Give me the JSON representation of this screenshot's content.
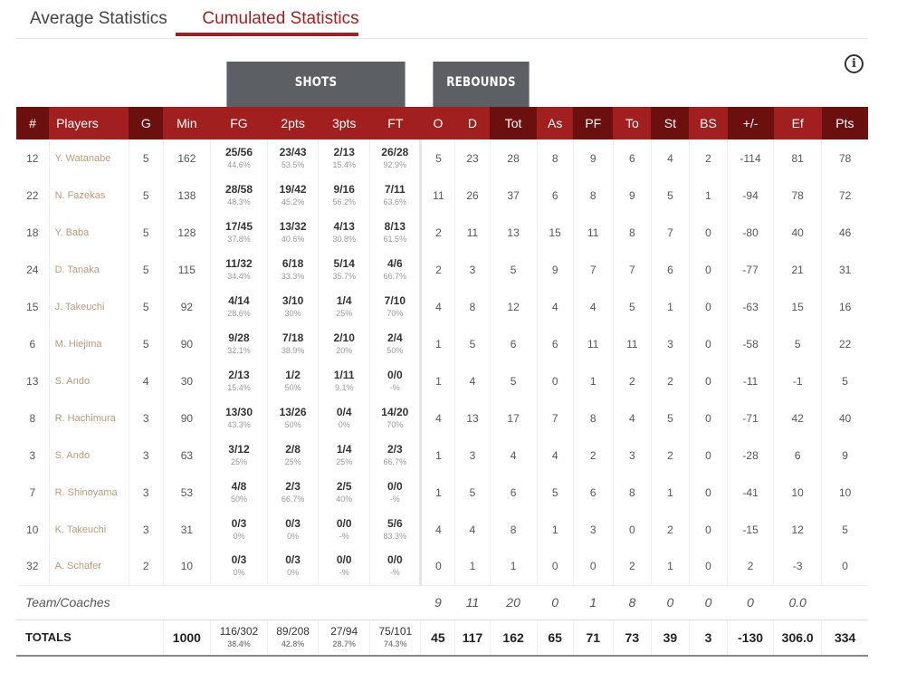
{
  "tabs": [
    "Average Statistics",
    "Cumulated Statistics"
  ],
  "active_tab": "Cumulated Statistics",
  "groups": {
    "shots": "SHOTS",
    "rebounds": "REBOUNDS"
  },
  "info_icon": "i",
  "columns": [
    "#",
    "Players",
    "G",
    "Min",
    "FG",
    "2pts",
    "3pts",
    "FT",
    "O",
    "D",
    "Tot",
    "As",
    "PF",
    "To",
    "St",
    "BS",
    "+/-",
    "Ef",
    "Pts"
  ],
  "players": [
    {
      "num": "12",
      "name": "Y. Watanabe",
      "g": "5",
      "min": "162",
      "fg": "25/56",
      "fgp": "44.6%",
      "p2": "23/43",
      "p2p": "53.5%",
      "p3": "2/13",
      "p3p": "15.4%",
      "ft": "26/28",
      "ftp": "92.9%",
      "o": "5",
      "d": "23",
      "tot": "28",
      "as": "8",
      "pf": "9",
      "to": "6",
      "st": "4",
      "bs": "2",
      "pm": "-114",
      "ef": "81",
      "pts": "78"
    },
    {
      "num": "22",
      "name": "N. Fazekas",
      "g": "5",
      "min": "138",
      "fg": "28/58",
      "fgp": "48.3%",
      "p2": "19/42",
      "p2p": "45.2%",
      "p3": "9/16",
      "p3p": "56.2%",
      "ft": "7/11",
      "ftp": "63.6%",
      "o": "11",
      "d": "26",
      "tot": "37",
      "as": "6",
      "pf": "8",
      "to": "9",
      "st": "5",
      "bs": "1",
      "pm": "-94",
      "ef": "78",
      "pts": "72"
    },
    {
      "num": "18",
      "name": "Y. Baba",
      "g": "5",
      "min": "128",
      "fg": "17/45",
      "fgp": "37.8%",
      "p2": "13/32",
      "p2p": "40.6%",
      "p3": "4/13",
      "p3p": "30.8%",
      "ft": "8/13",
      "ftp": "61.5%",
      "o": "2",
      "d": "11",
      "tot": "13",
      "as": "15",
      "pf": "11",
      "to": "8",
      "st": "7",
      "bs": "0",
      "pm": "-80",
      "ef": "40",
      "pts": "46"
    },
    {
      "num": "24",
      "name": "D. Tanaka",
      "g": "5",
      "min": "115",
      "fg": "11/32",
      "fgp": "34.4%",
      "p2": "6/18",
      "p2p": "33.3%",
      "p3": "5/14",
      "p3p": "35.7%",
      "ft": "4/6",
      "ftp": "66.7%",
      "o": "2",
      "d": "3",
      "tot": "5",
      "as": "9",
      "pf": "7",
      "to": "7",
      "st": "6",
      "bs": "0",
      "pm": "-77",
      "ef": "21",
      "pts": "31"
    },
    {
      "num": "15",
      "name": "J. Takeuchi",
      "g": "5",
      "min": "92",
      "fg": "4/14",
      "fgp": "28.6%",
      "p2": "3/10",
      "p2p": "30%",
      "p3": "1/4",
      "p3p": "25%",
      "ft": "7/10",
      "ftp": "70%",
      "o": "4",
      "d": "8",
      "tot": "12",
      "as": "4",
      "pf": "4",
      "to": "5",
      "st": "1",
      "bs": "0",
      "pm": "-63",
      "ef": "15",
      "pts": "16"
    },
    {
      "num": "6",
      "name": "M. Hiejima",
      "g": "5",
      "min": "90",
      "fg": "9/28",
      "fgp": "32.1%",
      "p2": "7/18",
      "p2p": "38.9%",
      "p3": "2/10",
      "p3p": "20%",
      "ft": "2/4",
      "ftp": "50%",
      "o": "1",
      "d": "5",
      "tot": "6",
      "as": "6",
      "pf": "11",
      "to": "11",
      "st": "3",
      "bs": "0",
      "pm": "-58",
      "ef": "5",
      "pts": "22"
    },
    {
      "num": "13",
      "name": "S. Ando",
      "g": "4",
      "min": "30",
      "fg": "2/13",
      "fgp": "15.4%",
      "p2": "1/2",
      "p2p": "50%",
      "p3": "1/11",
      "p3p": "9.1%",
      "ft": "0/0",
      "ftp": "-%",
      "o": "1",
      "d": "4",
      "tot": "5",
      "as": "0",
      "pf": "1",
      "to": "2",
      "st": "2",
      "bs": "0",
      "pm": "-11",
      "ef": "-1",
      "pts": "5"
    },
    {
      "num": "8",
      "name": "R. Hachimura",
      "g": "3",
      "min": "90",
      "fg": "13/30",
      "fgp": "43.3%",
      "p2": "13/26",
      "p2p": "50%",
      "p3": "0/4",
      "p3p": "0%",
      "ft": "14/20",
      "ftp": "70%",
      "o": "4",
      "d": "13",
      "tot": "17",
      "as": "7",
      "pf": "8",
      "to": "4",
      "st": "5",
      "bs": "0",
      "pm": "-71",
      "ef": "42",
      "pts": "40"
    },
    {
      "num": "3",
      "name": "S. Ando",
      "g": "3",
      "min": "63",
      "fg": "3/12",
      "fgp": "25%",
      "p2": "2/8",
      "p2p": "25%",
      "p3": "1/4",
      "p3p": "25%",
      "ft": "2/3",
      "ftp": "66.7%",
      "o": "1",
      "d": "3",
      "tot": "4",
      "as": "4",
      "pf": "2",
      "to": "3",
      "st": "2",
      "bs": "0",
      "pm": "-28",
      "ef": "6",
      "pts": "9"
    },
    {
      "num": "7",
      "name": "R. Shinoyama",
      "g": "3",
      "min": "53",
      "fg": "4/8",
      "fgp": "50%",
      "p2": "2/3",
      "p2p": "66.7%",
      "p3": "2/5",
      "p3p": "40%",
      "ft": "0/0",
      "ftp": "-%",
      "o": "1",
      "d": "5",
      "tot": "6",
      "as": "5",
      "pf": "6",
      "to": "8",
      "st": "1",
      "bs": "0",
      "pm": "-41",
      "ef": "10",
      "pts": "10"
    },
    {
      "num": "10",
      "name": "K. Takeuchi",
      "g": "3",
      "min": "31",
      "fg": "0/3",
      "fgp": "0%",
      "p2": "0/3",
      "p2p": "0%",
      "p3": "0/0",
      "p3p": "-%",
      "ft": "5/6",
      "ftp": "83.3%",
      "o": "4",
      "d": "4",
      "tot": "8",
      "as": "1",
      "pf": "3",
      "to": "0",
      "st": "2",
      "bs": "0",
      "pm": "-15",
      "ef": "12",
      "pts": "5"
    },
    {
      "num": "32",
      "name": "A. Schafer",
      "g": "2",
      "min": "10",
      "fg": "0/3",
      "fgp": "0%",
      "p2": "0/3",
      "p2p": "0%",
      "p3": "0/0",
      "p3p": "-%",
      "ft": "0/0",
      "ftp": "-%",
      "o": "0",
      "d": "1",
      "tot": "1",
      "as": "0",
      "pf": "0",
      "to": "2",
      "st": "1",
      "bs": "0",
      "pm": "2",
      "ef": "-3",
      "pts": "0"
    }
  ],
  "team": {
    "label": "Team/Coaches",
    "o": "9",
    "d": "11",
    "tot": "20",
    "as": "0",
    "pf": "1",
    "to": "8",
    "st": "0",
    "bs": "0",
    "pm": "0",
    "ef": "0.0"
  },
  "totals": {
    "label": "TOTALS",
    "min": "1000",
    "fg": "116/302",
    "fgp": "38.4%",
    "p2": "89/208",
    "p2p": "42.8%",
    "p3": "27/94",
    "p3p": "28.7%",
    "ft": "75/101",
    "ftp": "74.3%",
    "o": "45",
    "d": "117",
    "tot": "162",
    "as": "65",
    "pf": "71",
    "to": "73",
    "st": "39",
    "bs": "3",
    "pm": "-130",
    "ef": "306.0",
    "pts": "334"
  }
}
